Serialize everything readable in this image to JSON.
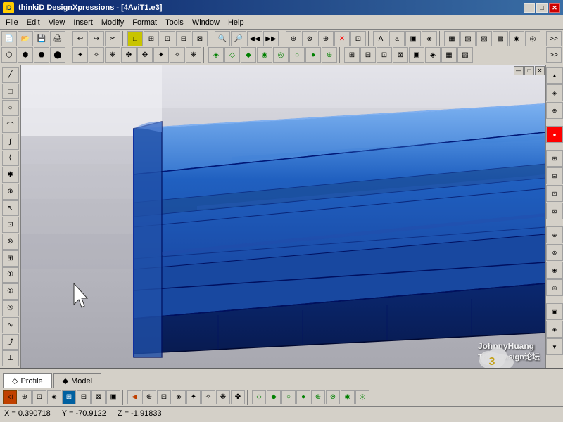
{
  "titleBar": {
    "appName": "thinkiD DesignXpressions",
    "fileName": "[4AviT1.e3]",
    "fullTitle": "thinkiD DesignXpressions - [4AviT1.e3]"
  },
  "menuBar": {
    "items": [
      "File",
      "Edit",
      "View",
      "Insert",
      "Modify",
      "Format",
      "Tools",
      "Window",
      "Help"
    ]
  },
  "windowControls": {
    "minimize": "—",
    "maximize": "□",
    "close": "✕"
  },
  "innerWindowControls": {
    "minimize": "—",
    "maximize": "□",
    "close": "✕"
  },
  "tabs": [
    {
      "label": "Profile",
      "active": true,
      "icon": "◇"
    },
    {
      "label": "Model",
      "active": false,
      "icon": "◆"
    }
  ],
  "statusBar": {
    "x": "X = 0.390718",
    "y": "Y = -70.9122",
    "z": "Z = -1.91833"
  },
  "watermark": {
    "number": "3",
    "line1": "JohnnyHuang",
    "line2": "ThinkDesign论坛"
  },
  "colors": {
    "bodyBlue": "#1e5fb8",
    "bodyBlueDark": "#0a3a7a",
    "bodyBlueMid": "#3070c8",
    "background": "#b0b0b8",
    "toolbar": "#d4d0c8"
  }
}
